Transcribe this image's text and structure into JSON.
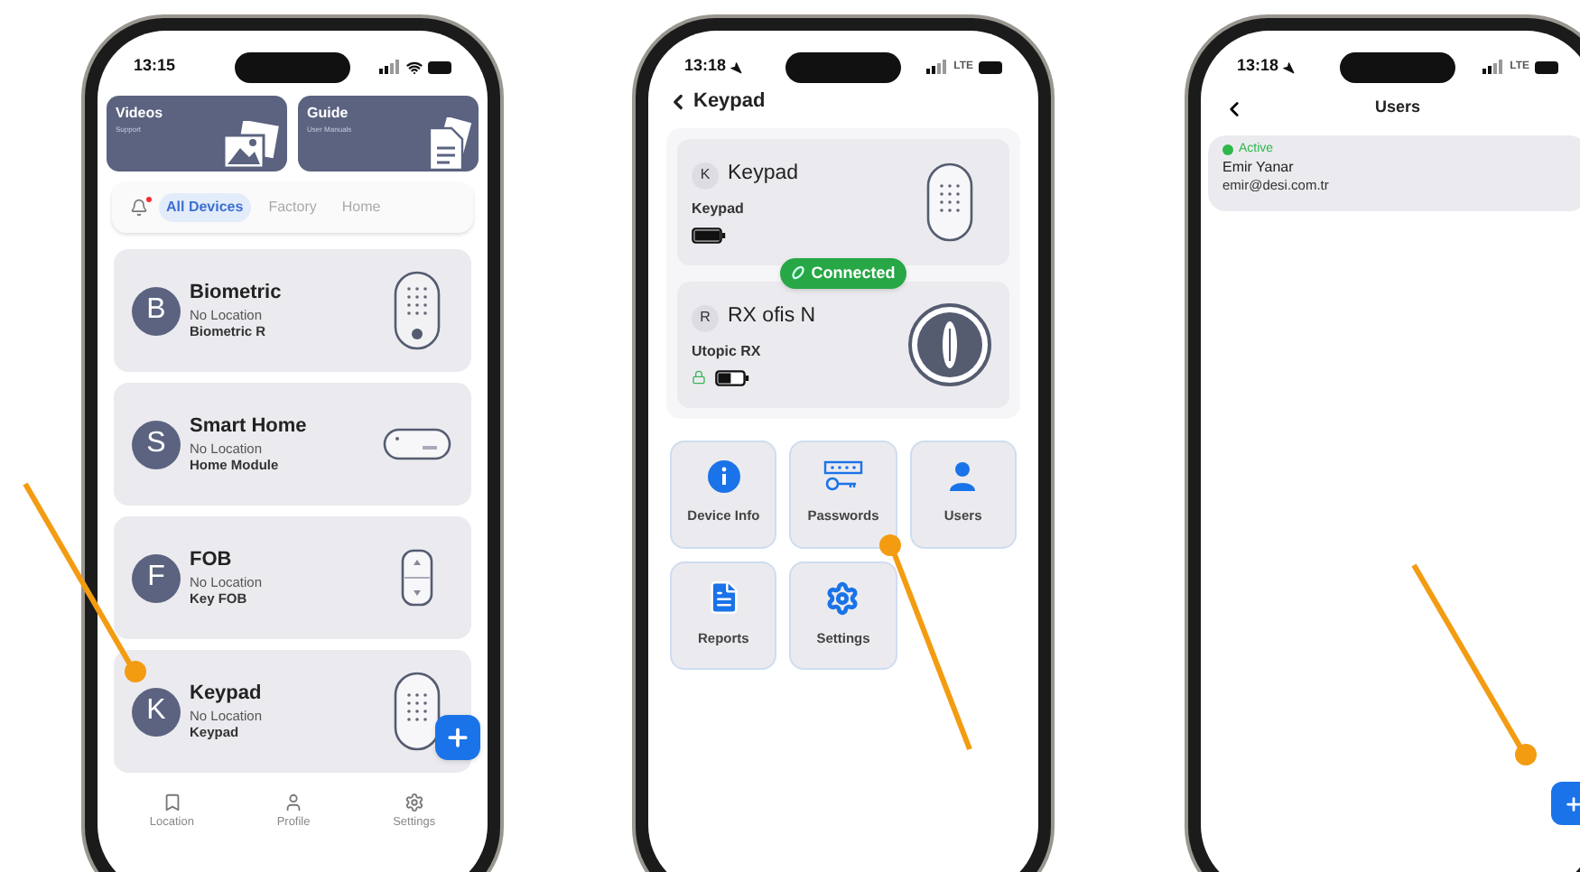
{
  "phones": [
    {
      "kind": "devices",
      "status_bar": {
        "time": "13:15",
        "location_arrow": false
      },
      "promo_cards": [
        {
          "title": "Videos",
          "subtitle": "Support",
          "kind": "photos"
        },
        {
          "title": "Guide",
          "subtitle": "User Manuals",
          "kind": "document"
        }
      ],
      "notification_unread": true,
      "filters": [
        {
          "label": "All Devices",
          "selected": true
        },
        {
          "label": "Factory",
          "selected": false
        },
        {
          "label": "Home",
          "selected": false
        }
      ],
      "devices": [
        {
          "initial": "B",
          "name": "Biometric",
          "location": "No Location",
          "model": "Biometric R",
          "kind": "biometric"
        },
        {
          "initial": "S",
          "name": "Smart Home",
          "location": "No Location",
          "model": "Home Module",
          "kind": "module"
        },
        {
          "initial": "F",
          "name": "FOB",
          "location": "No Location",
          "model": "Key FOB",
          "kind": "fob"
        },
        {
          "initial": "K",
          "name": "Keypad",
          "location": "No Location",
          "model": "Keypad",
          "kind": "keypad"
        }
      ],
      "nav": [
        {
          "label": "Location",
          "kind": "bookmark"
        },
        {
          "label": "Profile",
          "kind": "person"
        },
        {
          "label": "Settings",
          "kind": "gear"
        }
      ]
    },
    {
      "kind": "detail",
      "status_bar": {
        "time": "13:18",
        "location_arrow": true,
        "network": "LTE"
      },
      "title": "Keypad",
      "devices": [
        {
          "initial": "K",
          "name": "Keypad",
          "model": "Keypad",
          "kind": "keypad",
          "locked": false,
          "battery_low": false
        },
        {
          "initial": "R",
          "name": "RX ofis N",
          "model": "Utopic RX",
          "kind": "round",
          "locked": true,
          "battery_low": true
        }
      ],
      "connection": "Connected",
      "tiles": [
        {
          "label": "Device Info",
          "kind": "info"
        },
        {
          "label": "Passwords",
          "kind": "password"
        },
        {
          "label": "Users",
          "kind": "user"
        },
        {
          "label": "Reports",
          "kind": "report"
        },
        {
          "label": "Settings",
          "kind": "gear"
        }
      ]
    },
    {
      "kind": "users",
      "status_bar": {
        "time": "13:18",
        "location_arrow": true,
        "network": "LTE"
      },
      "title": "Users",
      "users": [
        {
          "status": "Active",
          "active": true,
          "name": "Emir Yanar",
          "email": "emir@desi.com.tr"
        }
      ]
    }
  ]
}
